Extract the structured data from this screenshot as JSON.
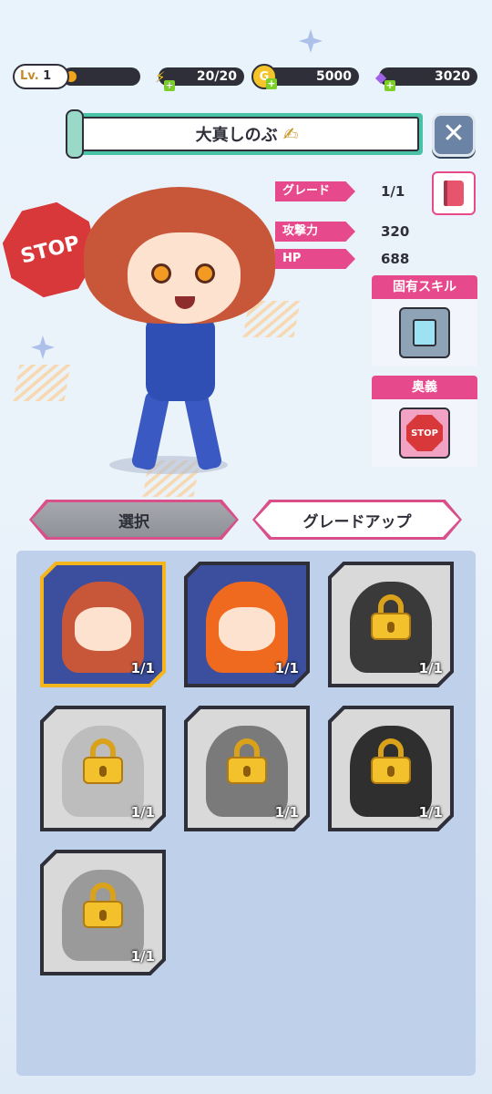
{
  "topbar": {
    "level_prefix": "Lv.",
    "level": "1",
    "level_progress": 0.15,
    "stamina": "20/20",
    "coins": "5000",
    "gems": "3020"
  },
  "character": {
    "name": "大真しのぶ",
    "sign_text": "STOP"
  },
  "stats": {
    "grade_label": "グレード",
    "grade_value": "1/1",
    "attack_label": "攻撃力",
    "attack_value": "320",
    "hp_label": "HP",
    "hp_value": "688"
  },
  "skills": {
    "unique_skill_label": "固有スキル",
    "ultimate_label": "奥義",
    "ultimate_icon_text": "STOP"
  },
  "tabs": {
    "select_label": "選択",
    "gradeup_label": "グレードアップ"
  },
  "roster": [
    {
      "count": "1/1",
      "locked": false,
      "selected": true
    },
    {
      "count": "1/1",
      "locked": false,
      "selected": false
    },
    {
      "count": "1/1",
      "locked": true,
      "selected": false
    },
    {
      "count": "1/1",
      "locked": true,
      "selected": false
    },
    {
      "count": "1/1",
      "locked": true,
      "selected": false
    },
    {
      "count": "1/1",
      "locked": true,
      "selected": false
    },
    {
      "count": "1/1",
      "locked": true,
      "selected": false
    }
  ],
  "colors": {
    "accent_pink": "#e64a8c",
    "banner_teal": "#4ac2a8",
    "selected_gold": "#f5b51c"
  }
}
